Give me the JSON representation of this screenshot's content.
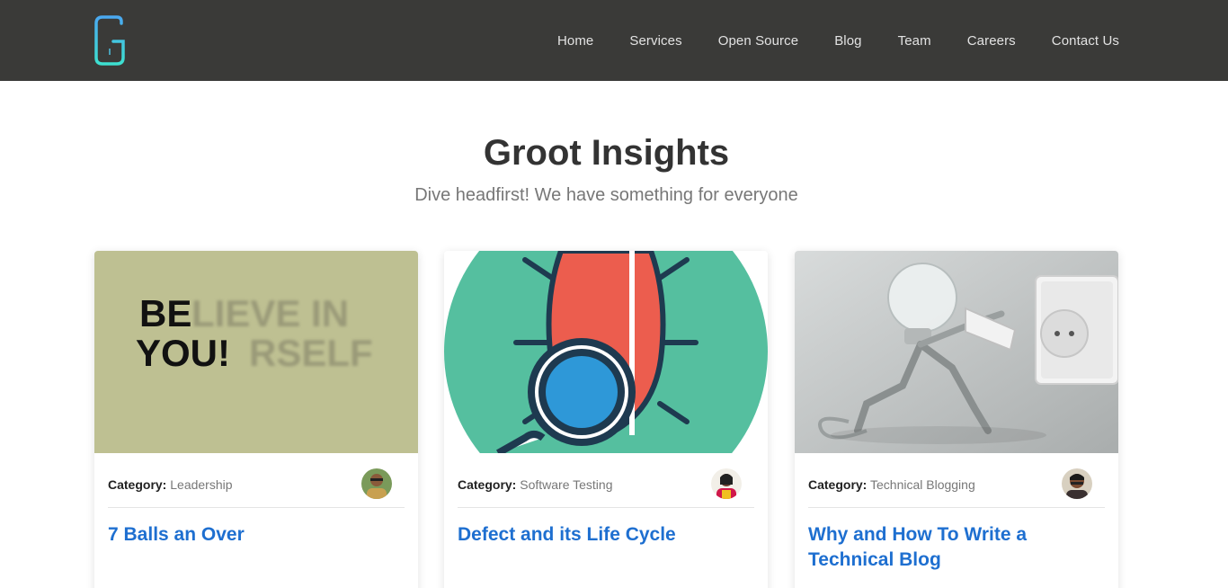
{
  "brand": {
    "logo_letter": "G",
    "logo_icon": "groot-g-logo"
  },
  "nav": {
    "items": [
      "Home",
      "Services",
      "Open Source",
      "Blog",
      "Team",
      "Careers",
      "Contact Us"
    ]
  },
  "hero": {
    "title": "Groot Insights",
    "subtitle": "Dive headfirst! We have something for everyone"
  },
  "posts": [
    {
      "category_label": "Category:",
      "category": "Leadership",
      "title": "7 Balls an Over",
      "image_text_line1_bold": "BE",
      "image_text_line1_blur": "LIEVE IN",
      "image_text_line2_bold": "YOU!",
      "image_text_line2_blur": "RSELF"
    },
    {
      "category_label": "Category:",
      "category": "Software Testing",
      "title": "Defect and its Life Cycle"
    },
    {
      "category_label": "Category:",
      "category": "Technical Blogging",
      "title": "Why and How To Write a Technical Blog"
    }
  ],
  "colors": {
    "navbar": "#3a3a38",
    "link": "#1e6fd0",
    "logo_gradient_top": "#4aa8f0",
    "logo_gradient_bottom": "#3de0d0"
  }
}
